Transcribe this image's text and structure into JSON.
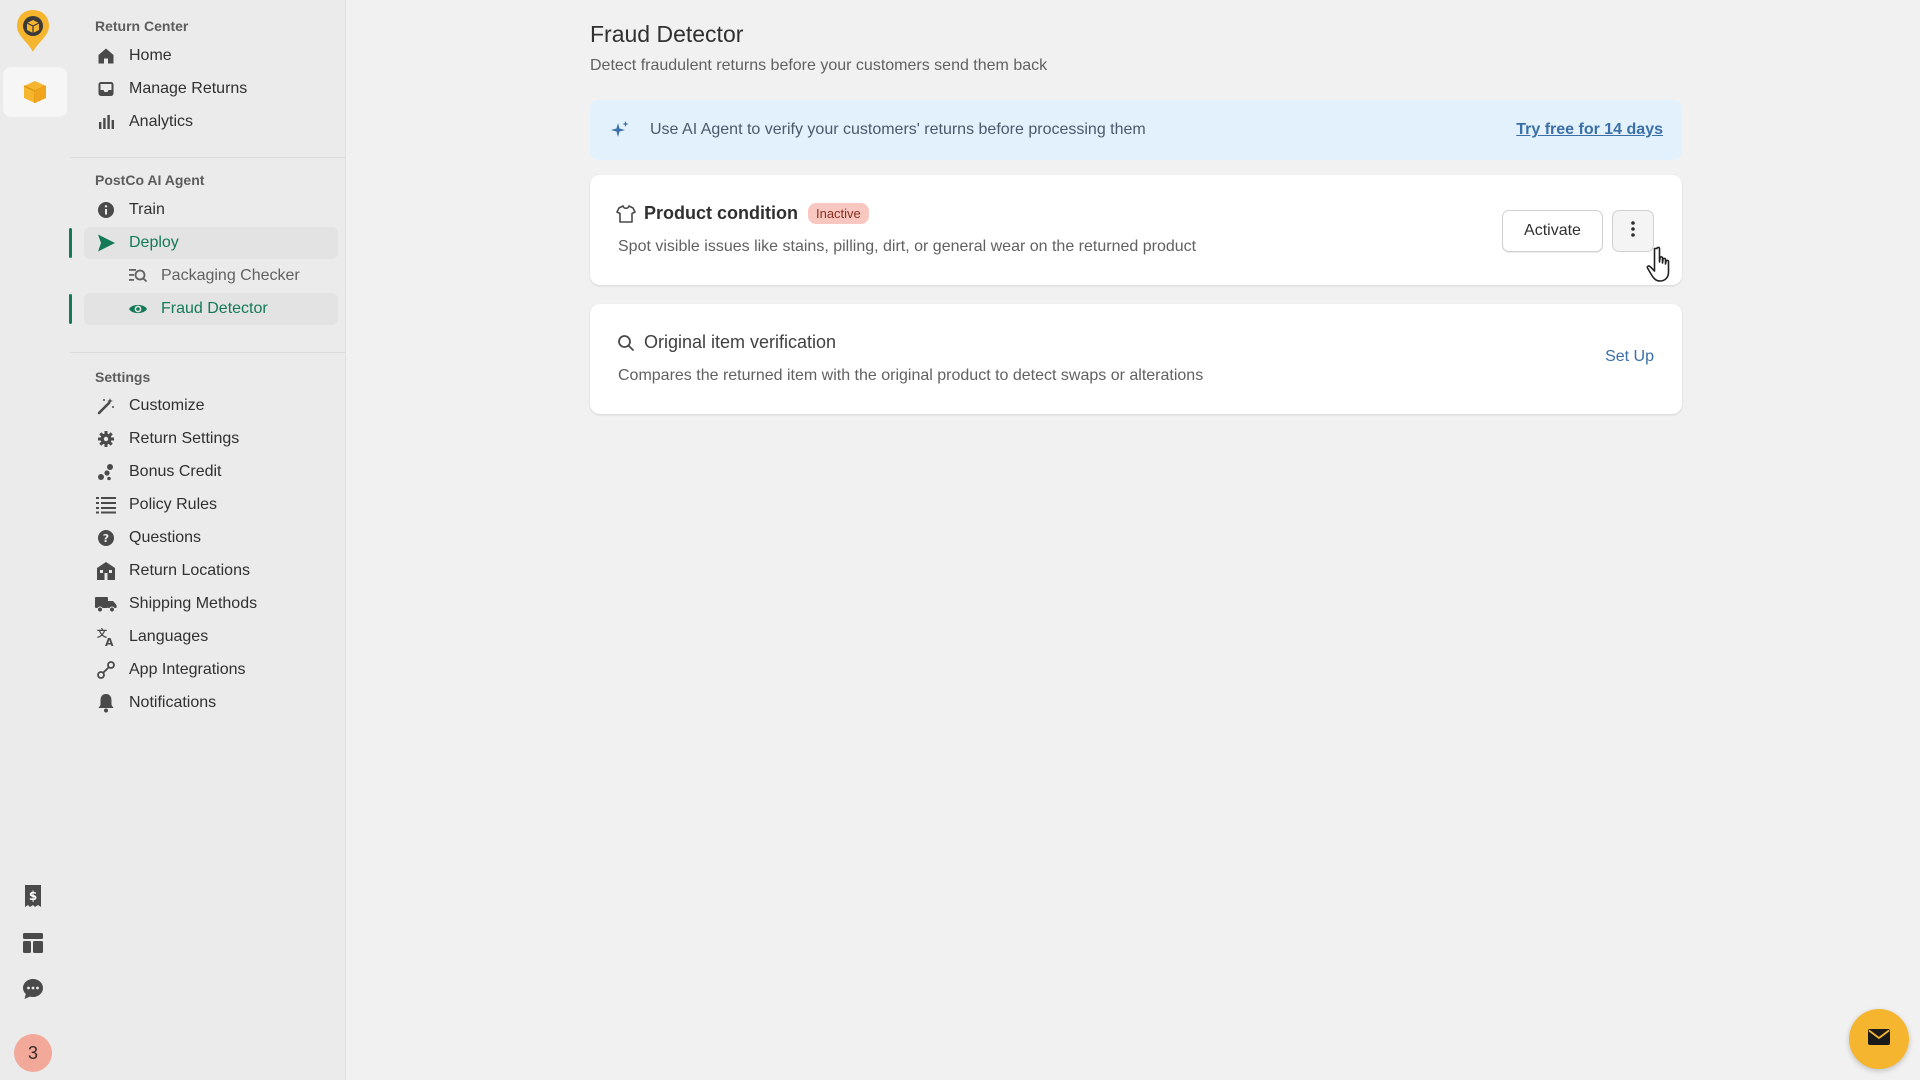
{
  "colors": {
    "accent": "#137a55",
    "brand": "#f5b52e",
    "link": "#3a6fa8",
    "banner_bg": "#e3f1fd",
    "badge_bg": "#f8c8c0"
  },
  "rail": {
    "icons": [
      "postco-logo-icon",
      "box-icon",
      "receipt-dollar-icon",
      "layout-icon",
      "chat-icon"
    ],
    "badge_count": "3"
  },
  "sidebar": {
    "sections": [
      {
        "title": "Return Center",
        "items": [
          {
            "label": "Home",
            "icon": "home-icon"
          },
          {
            "label": "Manage Returns",
            "icon": "inbox-icon"
          },
          {
            "label": "Analytics",
            "icon": "bar-chart-icon"
          }
        ]
      },
      {
        "title": "PostCo AI Agent",
        "items": [
          {
            "label": "Train",
            "icon": "info-icon"
          },
          {
            "label": "Deploy",
            "icon": "send-icon",
            "active": true
          },
          {
            "label": "Packaging Checker",
            "icon": "search-list-icon",
            "sub": true
          },
          {
            "label": "Fraud Detector",
            "icon": "eye-icon",
            "sub": true,
            "active": true
          }
        ]
      },
      {
        "title": "Settings",
        "items": [
          {
            "label": "Customize",
            "icon": "magic-wand-icon"
          },
          {
            "label": "Return Settings",
            "icon": "gear-icon"
          },
          {
            "label": "Bonus Credit",
            "icon": "coins-icon"
          },
          {
            "label": "Policy Rules",
            "icon": "list-icon"
          },
          {
            "label": "Questions",
            "icon": "question-icon"
          },
          {
            "label": "Return Locations",
            "icon": "building-icon"
          },
          {
            "label": "Shipping Methods",
            "icon": "truck-icon"
          },
          {
            "label": "Languages",
            "icon": "translate-icon"
          },
          {
            "label": "App Integrations",
            "icon": "integration-icon"
          },
          {
            "label": "Notifications",
            "icon": "bell-icon"
          }
        ]
      }
    ]
  },
  "main": {
    "title": "Fraud Detector",
    "subtitle": "Detect fraudulent returns before your customers send them back",
    "banner": {
      "text": "Use AI Agent to verify your customers' returns before processing them",
      "link": "Try free for 14 days"
    },
    "cards": [
      {
        "title": "Product condition",
        "badge": "Inactive",
        "description": "Spot visible issues like stains, pilling, dirt, or general wear on the returned product",
        "action": "Activate"
      },
      {
        "title": "Original item verification",
        "description": "Compares the returned item with the original product to detect swaps or alterations",
        "action": "Set Up"
      }
    ]
  }
}
